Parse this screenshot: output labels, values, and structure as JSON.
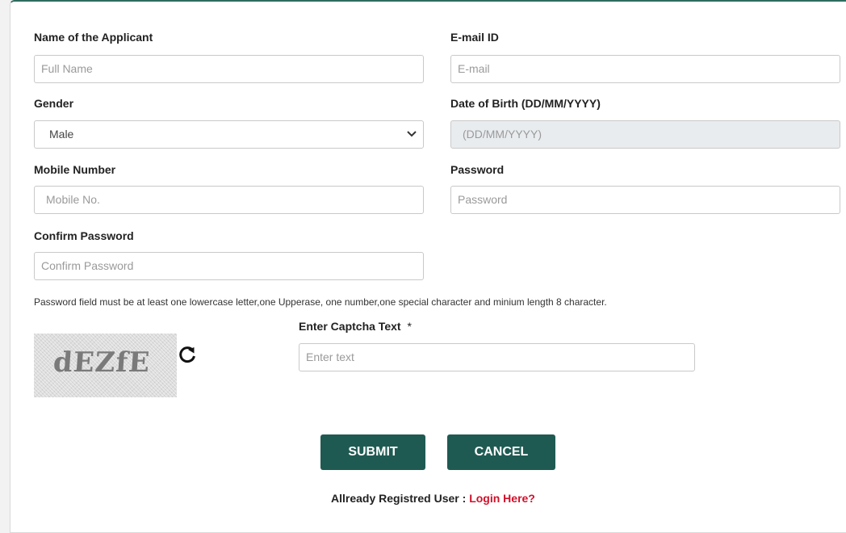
{
  "form": {
    "name": {
      "label": "Name of the Applicant",
      "placeholder": "Full Name"
    },
    "email": {
      "label": "E-mail ID",
      "placeholder": "E-mail"
    },
    "gender": {
      "label": "Gender",
      "value": "Male"
    },
    "dob": {
      "label": "Date of Birth (DD/MM/YYYY)",
      "placeholder": "(DD/MM/YYYY)"
    },
    "mobile": {
      "label": "Mobile Number",
      "placeholder": "Mobile No."
    },
    "password": {
      "label": "Password",
      "placeholder": "Password"
    },
    "confirm": {
      "label": "Confirm Password",
      "placeholder": "Confirm Password"
    },
    "password_note": "Password field must be at least one lowercase letter,one Upperase, one number,one special character and minium length 8 character.",
    "captcha": {
      "label": "Enter Captcha Text",
      "required_mark": "*",
      "image_text": "dEZfE",
      "placeholder": "Enter text"
    },
    "submit_label": "SUBMIT",
    "cancel_label": "CANCEL",
    "footer_text": "Allready Registred User :",
    "login_link": "Login Here?"
  },
  "colors": {
    "button": "#1f5a52",
    "link": "#d0102a",
    "accent": "#2e6b5e"
  },
  "icons": {
    "refresh": "refresh-icon",
    "select": "chevron-down-icon"
  }
}
